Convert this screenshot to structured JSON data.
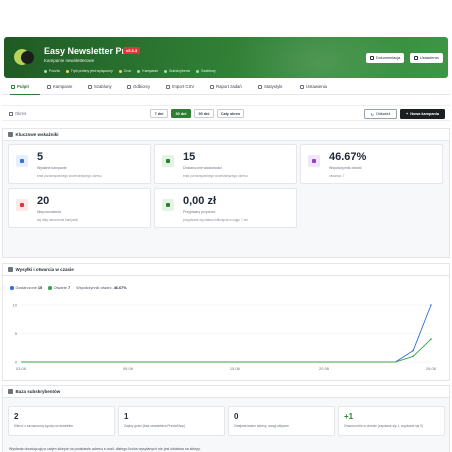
{
  "header": {
    "title": "Easy Newsletter Pro",
    "version": "v5.3.3",
    "subtitle": "Kampanie newsletterowe",
    "meta": [
      {
        "label": "Poczta",
        "color": "#9be39f"
      },
      {
        "label": "Tryb próbny jest wyłączony",
        "color": "#f0d264"
      },
      {
        "label": "Cron",
        "color": "#f0d264"
      },
      {
        "label": "Kampanie",
        "color": "#9be39f"
      },
      {
        "label": "Subskrybenci",
        "color": "#9be39f"
      },
      {
        "label": "Szablony",
        "color": "#9be39f"
      }
    ],
    "buttons": {
      "docs": "Dokumentacja",
      "settings": "Ustawienia"
    }
  },
  "nav": [
    {
      "label": "Pulpit",
      "active": true
    },
    {
      "label": "Kampanie"
    },
    {
      "label": "Szablony"
    },
    {
      "label": "Odbiorcy"
    },
    {
      "label": "Import CSV"
    },
    {
      "label": "Raport zadań"
    },
    {
      "label": "Statystyki"
    },
    {
      "label": "Ustawienia"
    }
  ],
  "toolbar": {
    "range_label": "Okres",
    "ranges": [
      {
        "label": "7 dni"
      },
      {
        "label": "30 dni",
        "active": true
      },
      {
        "label": "90 dni"
      },
      {
        "label": "Cały okres"
      }
    ],
    "refresh": "Odśwież",
    "new_campaign": "Nowa kampania"
  },
  "kpi_section": {
    "title": "Kluczowe wskaźniki",
    "cards": [
      {
        "value": "5",
        "label": "Wysłane kampanie",
        "desc": "brak porównywalnego wcześniejszego okresu",
        "icon": "mail-icon",
        "bg": "#e6efff",
        "fg": "#3b6fd4"
      },
      {
        "value": "15",
        "label": "Dostarczone wiadomości",
        "desc": "brak porównywalnego wcześniejszego okresu",
        "icon": "send-icon",
        "bg": "#e3f4e4",
        "fg": "#2e7d32"
      },
      {
        "value": "46.67%",
        "label": "Współczynnik otwarć",
        "desc": "otwarcia: 7",
        "icon": "eye-icon",
        "bg": "#f1e6f9",
        "fg": "#8e44c4"
      },
      {
        "value": "20",
        "label": "Niepowodzenia",
        "desc": "wg daty utworzenia kampanii",
        "icon": "warning-icon",
        "bg": "#fde7e7",
        "fg": "#d63a3a"
      },
      {
        "value": "0,00 zł",
        "label": "Przypisany przychód",
        "desc": "przypisane wg statusu kliknięcia w ciągu 7 dni",
        "icon": "cart-icon",
        "bg": "#e3f4e4",
        "fg": "#2e7d32"
      }
    ]
  },
  "chart_section": {
    "title": "Wysyłki i otwarcia w czasie",
    "legend": [
      {
        "name": "Dostarczone",
        "value": "15",
        "color": "#2f6fd6"
      },
      {
        "name": "Otwarte",
        "value": "7",
        "color": "#37a34a"
      },
      {
        "label": "Współczynnik otwarć:",
        "value": "46.67%"
      }
    ]
  },
  "chart_data": {
    "type": "line",
    "x_ticks": [
      "03.06",
      "09.06",
      "15.06",
      "20.06",
      "26.06"
    ],
    "y_ticks": [
      "0",
      "5",
      "10"
    ],
    "ylim": [
      0,
      10
    ],
    "x_count": 24,
    "series": [
      {
        "name": "Dostarczone",
        "color": "#2f6fd6",
        "values": [
          0,
          0,
          0,
          0,
          0,
          0,
          0,
          0,
          0,
          0,
          0,
          0,
          0,
          0,
          0,
          0,
          0,
          0,
          0,
          0,
          0,
          0,
          2,
          10
        ]
      },
      {
        "name": "Otwarte",
        "color": "#37a34a",
        "values": [
          0,
          0,
          0,
          0,
          0,
          0,
          0,
          0,
          0,
          0,
          0,
          0,
          0,
          0,
          0,
          0,
          0,
          0,
          0,
          0,
          0,
          0,
          1,
          4
        ]
      }
    ]
  },
  "subs_section": {
    "title": "Baza subskrybentów",
    "cards": [
      {
        "value": "2",
        "label": "Klienci z zaznaczoną zgodą na newsletter",
        "positive": false
      },
      {
        "value": "1",
        "label": "Zapisy gości (lista newslettera PrestaShop)",
        "positive": false
      },
      {
        "value": "0",
        "label": "Zarejestrowane adresy, uwagi aktywne",
        "positive": false
      },
      {
        "value": "+1",
        "label": "Zmiana netto w okresie (zapisane się 1, wypisane się 0)",
        "positive": true
      }
    ],
    "note": "Wysłania obowiązują w całym sklepie na podstawie adresu e-mail, dlatego liczba wysyłanych nie jest działana na sklepy."
  }
}
